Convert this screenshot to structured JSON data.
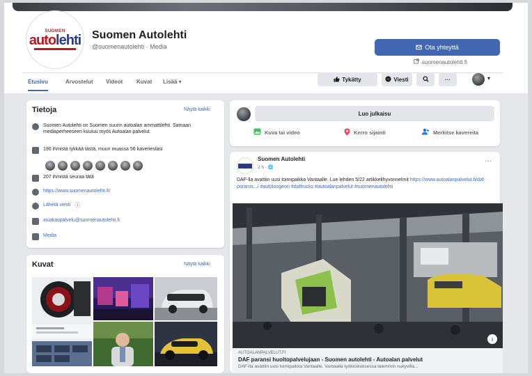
{
  "page": {
    "name": "Suomen Autolehti",
    "handle": "@suomenautolehti · Media",
    "logo_top": "SUOMEN",
    "logo_main_a": "auto",
    "logo_main_b": "lehti"
  },
  "header": {
    "follow_button": "Ota yhteyttä",
    "website": "suomenautolehti.fi",
    "tabs": [
      "Etusivu",
      "Arvostelut",
      "Videot",
      "Kuvat",
      "Lisää ▾"
    ],
    "like_button": "Tykätty",
    "messenger_button": "Viesti",
    "more_button": "···"
  },
  "about": {
    "title": "Tietoja",
    "see_all": "Näytä kaikki",
    "description": "Suomen Autolehti on Suomen suurin autoalan ammattilehti. Samaan mediaperheeseen kuuluu myös Autoalan palvelut.",
    "likes": "190 ihmistä tykkää tästä, muun muassa 56 kaveriestasi",
    "followers": "207 ihmistä seuraa tätä",
    "website": "https://www.suomenautolehti.fi/",
    "message": "Lähetä viesti",
    "email": "asiakaspalvelu@suomenautolehti.fi",
    "category": "Media"
  },
  "photos": {
    "title": "Kuvat",
    "see_all": "Näytä kaikki"
  },
  "create_post": {
    "button": "Luo julkaisu",
    "actions": [
      "Kuva tai video",
      "Kerro sijainti",
      "Merkitse kavereita"
    ]
  },
  "post": {
    "author": "Suomen Autolehti",
    "meta": "2 h · 🌐",
    "text_a": "DAF-lla avattiin uusi toimipaikka Vantaalle. Lue lehden 5/22 artikkelihyvonnelmit",
    "text_link": "https://www.autoalanpalvelut.fi/daf-poraros.../ #autoloogeon #daftrucks #autoalanpalvelut #suomenautolehti",
    "link_domain": "AUTOALANPALVELUT.FI",
    "link_title": "DAF paransi huoltopalvelujaan - Suomen autolehti - Autoalan palvelut",
    "link_desc": "DAF-lla avattiin uusi toimipaikka Vantaalle. Vantaalla työkeskuksessa laiemmin nukyvilla...",
    "more": "···"
  },
  "colors": {
    "accent": "#4267b2",
    "background": "#e6e7ea",
    "logo_red": "#c4161c",
    "logo_blue": "#2d3a8c"
  }
}
